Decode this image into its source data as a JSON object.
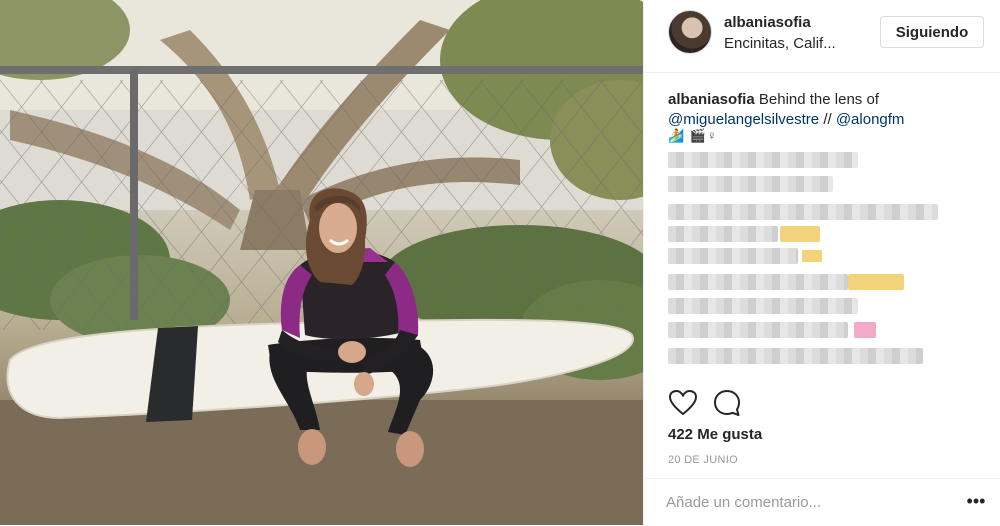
{
  "post": {
    "image_alt": "Mujer con traje de neopreno sentada sobre una tabla de surf frente a una valla",
    "author": {
      "username": "albaniasofia",
      "location": "Encinitas, Calif...",
      "follow_label": "Siguiendo"
    },
    "caption": {
      "username": "albaniasofia",
      "text": "Behind the lens of",
      "mention_1": "@miguelangelsilvestre",
      "separator": "//",
      "mention_2": "@alongfm",
      "emoji": "🏄 🎬♀"
    },
    "likes": "422 Me gusta",
    "date": "20 DE JUNIO",
    "comment": {
      "placeholder": "Añade un comentario...",
      "more_label": "•••"
    }
  },
  "icons": {
    "like": "heart-icon",
    "comment": "comment-bubble-icon",
    "more": "more-options-icon"
  },
  "colors": {
    "mention": "#003569",
    "border": "#efefef",
    "muted": "#999999"
  }
}
